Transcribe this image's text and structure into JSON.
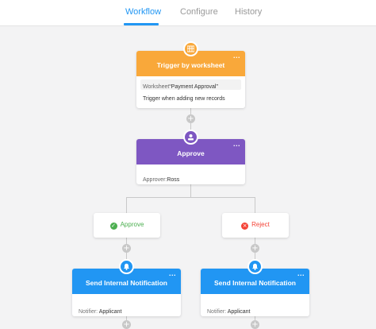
{
  "tabs": [
    {
      "label": "Workflow",
      "active": true
    },
    {
      "label": "Configure",
      "active": false
    },
    {
      "label": "History",
      "active": false
    }
  ],
  "trigger": {
    "title": "Trigger by worksheet",
    "menu": "...",
    "worksheet_label": "Worksheet",
    "worksheet_value": "“Payment Approval”",
    "description": "Trigger when adding new records",
    "icon": "grid-icon",
    "color": "#f9a83a"
  },
  "approve": {
    "title": "Approve",
    "menu": "...",
    "approver_label": "Approver:",
    "approver_value": "Ross",
    "icon": "person-icon",
    "color": "#7e57c2"
  },
  "branches": {
    "approve": {
      "label": "Approve",
      "icon": "check-icon",
      "color": "#4caf50"
    },
    "reject": {
      "label": "Reject",
      "icon": "close-icon",
      "color": "#f44336"
    }
  },
  "notifications": [
    {
      "title": "Send Internal Notification",
      "menu": "...",
      "notifier_label": "Notifier: ",
      "notifier_value": "Applicant",
      "icon": "bell-icon"
    },
    {
      "title": "Send Internal Notification",
      "menu": "...",
      "notifier_label": "Notifier: ",
      "notifier_value": "Applicant",
      "icon": "bell-icon"
    }
  ],
  "plus_label": "+",
  "colors": {
    "accent": "#2196f3",
    "notify": "#2196f3"
  }
}
